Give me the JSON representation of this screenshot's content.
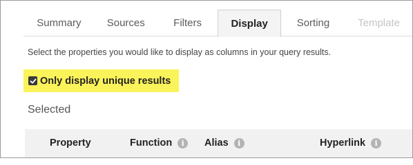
{
  "tabs": [
    {
      "label": "Summary",
      "state": "normal"
    },
    {
      "label": "Sources",
      "state": "normal"
    },
    {
      "label": "Filters",
      "state": "normal"
    },
    {
      "label": "Display",
      "state": "active"
    },
    {
      "label": "Sorting",
      "state": "normal"
    },
    {
      "label": "Template",
      "state": "disabled"
    }
  ],
  "display": {
    "description": "Select the properties you would like to display as columns in your query results.",
    "unique_checkbox": {
      "label": "Only display unique results",
      "checked": true,
      "highlight_color": "#fbf35a"
    },
    "selected_heading": "Selected",
    "columns": [
      {
        "label": "Property",
        "info_icon": false
      },
      {
        "label": "Function",
        "info_icon": true
      },
      {
        "label": "Alias",
        "info_icon": true
      },
      {
        "label": "Hyperlink",
        "info_icon": true
      }
    ],
    "info_glyph": "i"
  }
}
